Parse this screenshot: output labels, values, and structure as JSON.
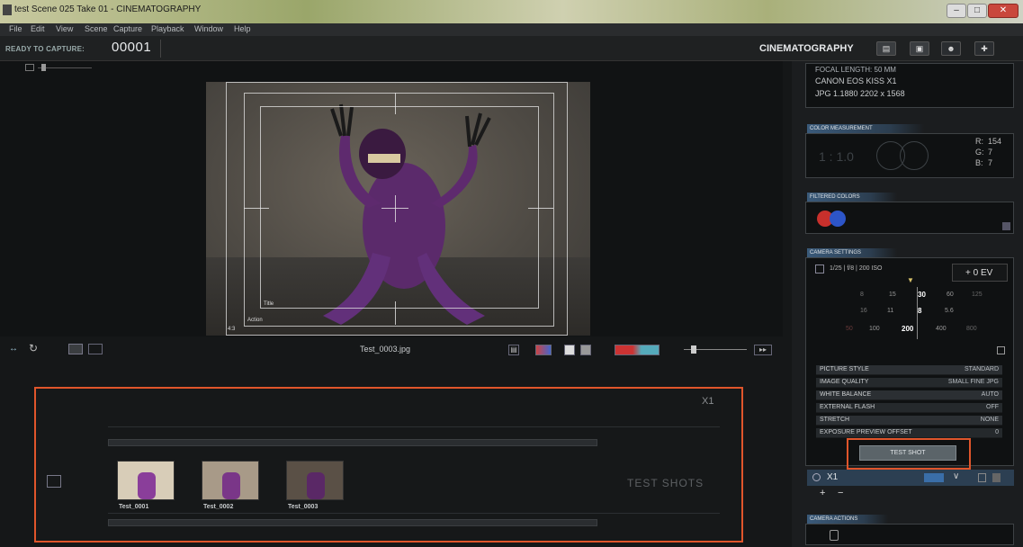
{
  "window": {
    "title": "test Scene 025 Take 01 - CINEMATOGRAPHY"
  },
  "menu": [
    "File",
    "Edit",
    "View",
    "Scene",
    "Capture",
    "Playback",
    "Window",
    "Help"
  ],
  "topbar": {
    "ready_label": "READY TO CAPTURE:",
    "shot_number": "00001",
    "mode": "CINEMATOGRAPHY"
  },
  "viewer": {
    "frame_labels": [
      "Title",
      "Action",
      "4:3"
    ],
    "filename": "Test_0003.jpg"
  },
  "test_panel": {
    "camera": "X1",
    "section_label": "TEST SHOTS",
    "thumbnails": [
      {
        "caption": "Test_0001",
        "tint": "#d8cdb8"
      },
      {
        "caption": "Test_0002",
        "tint": "#a89a88"
      },
      {
        "caption": "Test_0003",
        "tint": "#5a5046"
      }
    ]
  },
  "sidebar": {
    "camera_info": [
      "FOCAL LENGTH: 50 MM",
      "CANON EOS KISS X1",
      "JPG  1.1880  2202 x 1568"
    ],
    "color_section": "COLOR MEASUREMENT",
    "ratio": "1 : 1.0",
    "rgb": {
      "r_label": "R:",
      "r": "154",
      "g_label": "G:",
      "g": "7",
      "b_label": "B:",
      "b": "7"
    },
    "filter_section": "FILTERED COLORS",
    "settings_section": "CAMERA SETTINGS",
    "exposure_summary": "1/25 | f/8 | 200 ISO",
    "ev": "+ 0 EV",
    "shutter_scale": [
      "8",
      "15",
      "30",
      "60",
      "125"
    ],
    "aperture_scale": [
      "16",
      "11",
      "8",
      "5.6"
    ],
    "iso_scale": [
      "50",
      "100",
      "200",
      "400",
      "800"
    ],
    "settings": [
      {
        "label": "PICTURE STYLE",
        "value": "STANDARD"
      },
      {
        "label": "IMAGE QUALITY",
        "value": "SMALL FINE JPG"
      },
      {
        "label": "WHITE BALANCE",
        "value": "AUTO"
      },
      {
        "label": "EXTERNAL FLASH",
        "value": "OFF"
      },
      {
        "label": "STRETCH",
        "value": "NONE"
      },
      {
        "label": "EXPOSURE PREVIEW OFFSET",
        "value": "0"
      }
    ],
    "test_shot_button": "TEST SHOT",
    "camera_row": "X1",
    "add": "+",
    "remove": "−",
    "capture_section": "CAMERA ACTIONS"
  }
}
